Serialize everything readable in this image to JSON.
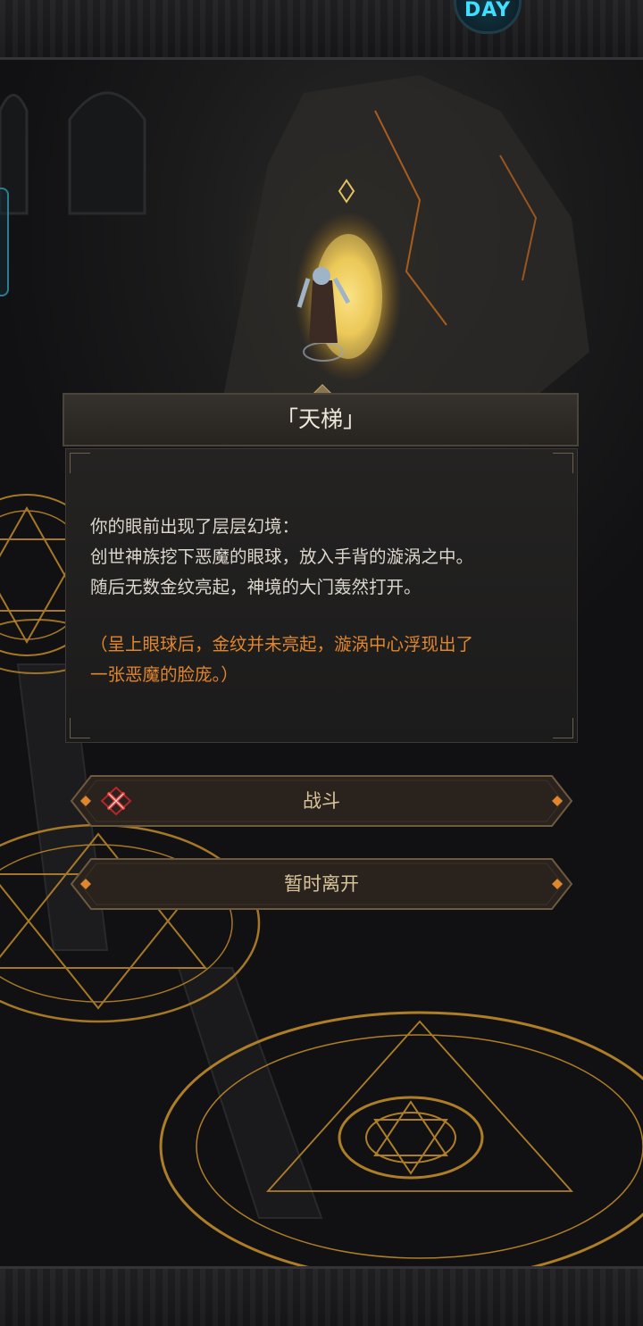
{
  "top_badge": {
    "text": "DAY",
    "icon": "day-badge-icon"
  },
  "dialog": {
    "title": "「天梯」",
    "lines": [
      "你的眼前出现了层层幻境：",
      "创世神族挖下恶魔的眼球，放入手背的漩涡之中。",
      "随后无数金纹亮起，神境的大门轰然打开。"
    ],
    "hint_lines": [
      "（呈上眼球后，金纹并未亮起，漩涡中心浮现出了",
      "一张恶魔的脸庞。）"
    ]
  },
  "options": [
    {
      "label": "战斗",
      "icon": "crossed-swords-icon"
    },
    {
      "label": "暂时离开"
    }
  ],
  "colors": {
    "title_text": "#efe7da",
    "body_text": "#dcd6cc",
    "hint_text": "#e0862e",
    "option_text": "#d8c49b",
    "magic_circle": "#c08a2a",
    "portal_glow": "#f2c94c"
  }
}
